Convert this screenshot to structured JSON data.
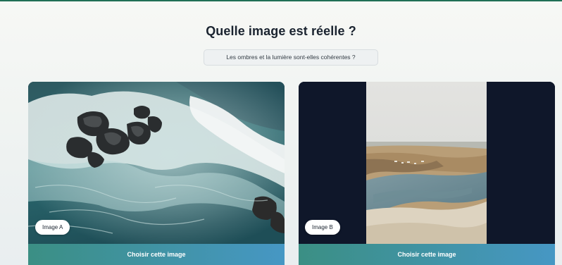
{
  "page": {
    "title": "Quelle image est réelle ?",
    "hint": "Les ombres et la lumière sont-elles cohérentes ?"
  },
  "cards": [
    {
      "badge": "Image A",
      "button_label": "Choisir cette image"
    },
    {
      "badge": "Image B",
      "button_label": "Choisir cette image"
    }
  ],
  "colors": {
    "accent_line": "#1f6f55",
    "button_gradient_start": "#3b8f84",
    "button_gradient_end": "#4697c4",
    "card_b_background": "#0f172a",
    "title_text": "#1b2430"
  }
}
